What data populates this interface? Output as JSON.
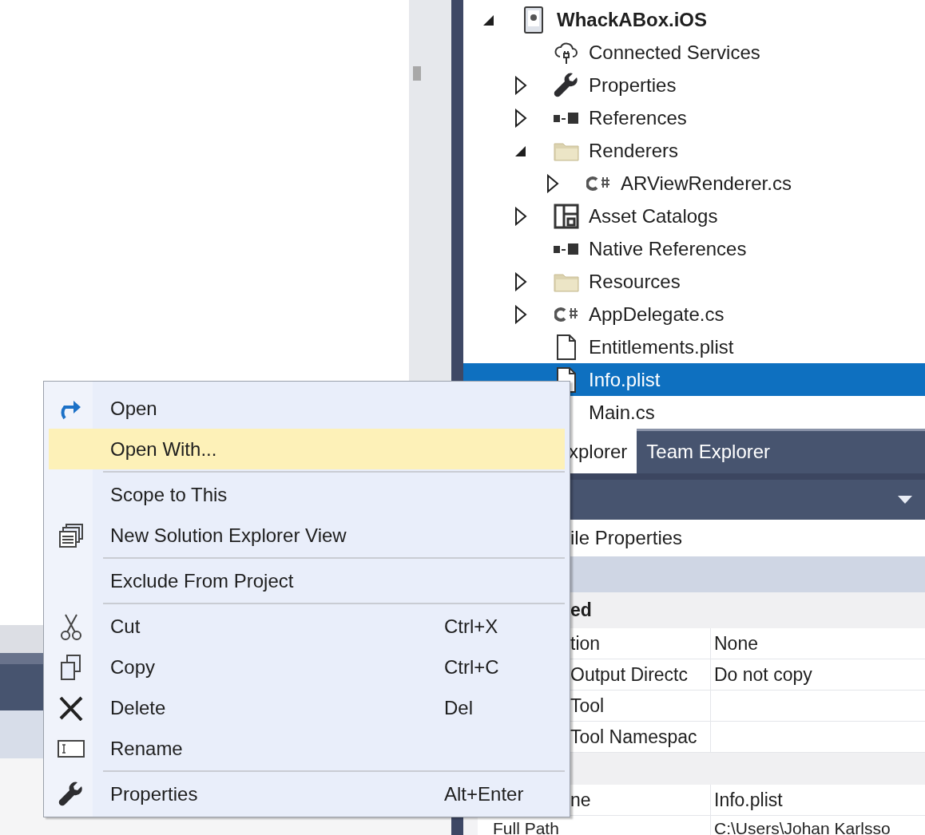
{
  "solution_explorer": {
    "tree": [
      {
        "label": "WhackABox.iOS",
        "kind": "project",
        "expanded": true,
        "selected": false,
        "children": [
          {
            "label": "Connected Services",
            "kind": "services",
            "selected": false
          },
          {
            "label": "Properties",
            "kind": "properties",
            "expanded": false,
            "selected": false
          },
          {
            "label": "References",
            "kind": "references",
            "expanded": false,
            "selected": false
          },
          {
            "label": "Renderers",
            "kind": "folder",
            "expanded": true,
            "selected": false,
            "children": [
              {
                "label": "ARViewRenderer.cs",
                "kind": "source",
                "expanded": false,
                "selected": false
              }
            ]
          },
          {
            "label": "Asset Catalogs",
            "kind": "catalogs",
            "expanded": false,
            "selected": false
          },
          {
            "label": "Native References",
            "kind": "references",
            "selected": false
          },
          {
            "label": "Resources",
            "kind": "folder",
            "expanded": false,
            "selected": false
          },
          {
            "label": "AppDelegate.cs",
            "kind": "source",
            "expanded": false,
            "selected": false
          },
          {
            "label": "Entitlements.plist",
            "kind": "plist",
            "selected": false
          },
          {
            "label": "Info.plist",
            "kind": "plist",
            "selected": true
          },
          {
            "label": "Main.cs",
            "kind": "hidden",
            "selected": false
          }
        ]
      }
    ]
  },
  "tool_tabs": [
    {
      "label": "xplorer",
      "selected": true
    },
    {
      "label": "Team Explorer",
      "selected": false
    }
  ],
  "properties": {
    "title": "ile Properties",
    "rows": [
      {
        "kind": "category",
        "name": "ed"
      },
      {
        "kind": "property",
        "name": "tion",
        "value": "None",
        "covered": true
      },
      {
        "kind": "property",
        "name": "Output Directc",
        "value": "Do not copy",
        "covered": true
      },
      {
        "kind": "property",
        "name": "Tool",
        "covered": true
      },
      {
        "kind": "property",
        "name": "Tool Namespac",
        "covered": true
      },
      {
        "kind": "category"
      },
      {
        "kind": "property",
        "name": "ne",
        "value": "Info.plist",
        "covered": true
      },
      {
        "kind": "property",
        "name": "Full Path",
        "value": "C:\\Users\\Johan Karlsso",
        "covered": false
      }
    ]
  },
  "context_menu": [
    {
      "kind": "open",
      "label": "Open",
      "selected": false
    },
    {
      "kind": "plain",
      "label": "Open With...",
      "selected": true
    },
    {
      "kind": "separator"
    },
    {
      "kind": "plain",
      "label": "Scope to This",
      "selected": false
    },
    {
      "kind": "new-view",
      "label": "New Solution Explorer View",
      "selected": false
    },
    {
      "kind": "separator"
    },
    {
      "kind": "plain",
      "label": "Exclude From Project",
      "selected": false
    },
    {
      "kind": "separator"
    },
    {
      "kind": "cut",
      "label": "Cut",
      "shortcut": "Ctrl+X",
      "selected": false
    },
    {
      "kind": "copy",
      "label": "Copy",
      "shortcut": "Ctrl+C",
      "selected": false
    },
    {
      "kind": "delete",
      "label": "Delete",
      "shortcut": "Del",
      "selected": false
    },
    {
      "kind": "rename",
      "label": "Rename",
      "selected": false
    },
    {
      "kind": "separator"
    },
    {
      "kind": "properties",
      "label": "Properties",
      "shortcut": "Alt+Enter",
      "selected": false
    }
  ]
}
